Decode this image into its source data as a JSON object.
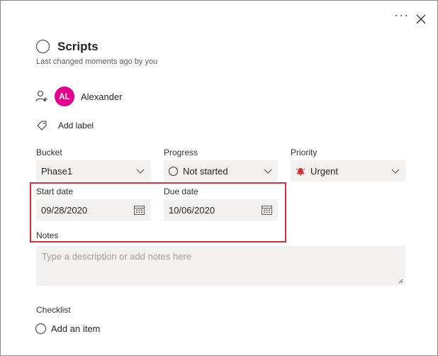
{
  "header": {
    "more_label": "···",
    "close_icon": "close-icon"
  },
  "task": {
    "title": "Scripts",
    "last_changed": "Last changed moments ago by you"
  },
  "assignee": {
    "initials": "AL",
    "name": "Alexander",
    "avatar_color": "#e3008c"
  },
  "label": {
    "add_label": "Add label"
  },
  "bucket": {
    "label": "Bucket",
    "value": "Phase1"
  },
  "progress": {
    "label": "Progress",
    "value": "Not started"
  },
  "priority": {
    "label": "Priority",
    "value": "Urgent",
    "color": "#d13438"
  },
  "start_date": {
    "label": "Start date",
    "value": "09/28/2020"
  },
  "due_date": {
    "label": "Due date",
    "value": "10/06/2020"
  },
  "notes": {
    "label": "Notes",
    "placeholder": "Type a description or add notes here"
  },
  "checklist": {
    "label": "Checklist",
    "add_item": "Add an item"
  },
  "colors": {
    "highlight_box": "#d13438",
    "field_bg": "#f3f2f1"
  }
}
